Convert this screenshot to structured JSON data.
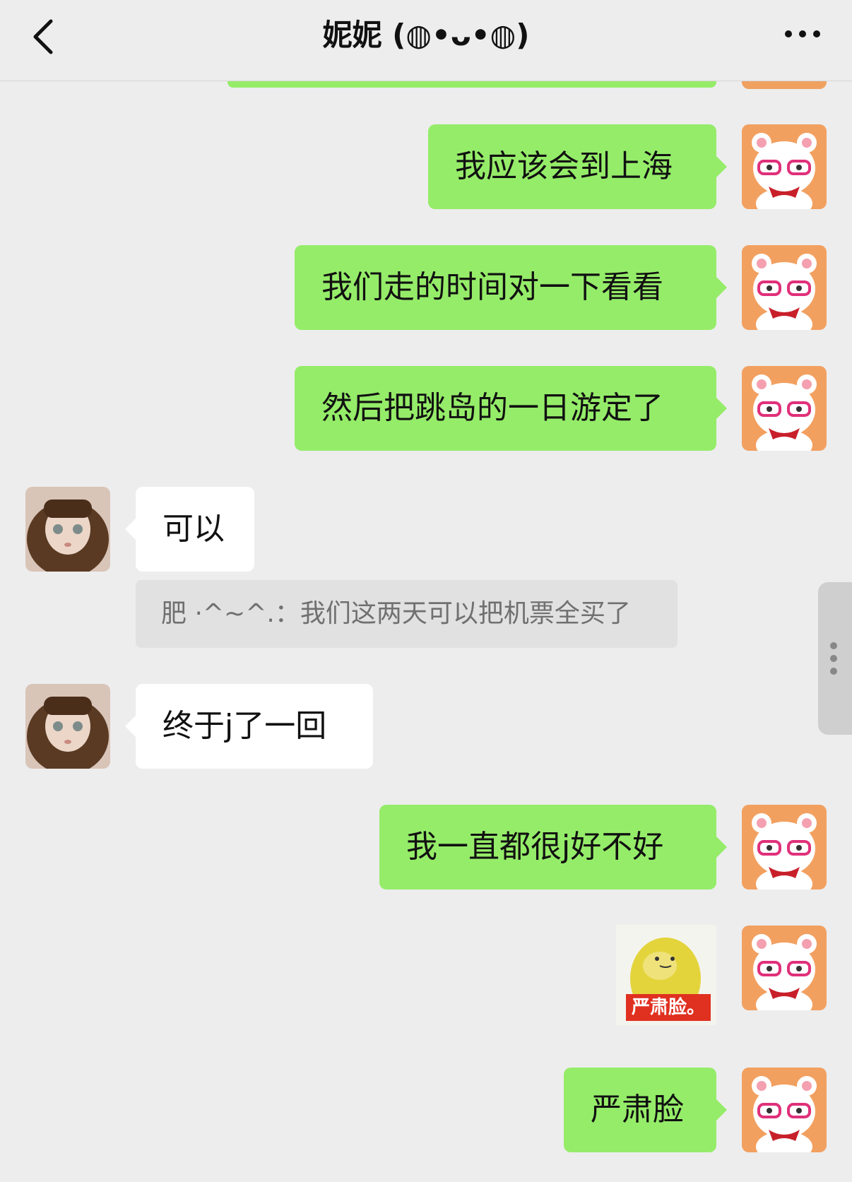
{
  "header": {
    "title": "妮妮 (◍•ᴗ•◍)",
    "back_icon": "chevron-left-icon",
    "more_icon": "more-dots-icon"
  },
  "colors": {
    "background": "#ededed",
    "self_bubble": "#95ec69",
    "other_bubble": "#ffffff",
    "quote_bg": "#e1e1e1",
    "quote_text": "#707070"
  },
  "messages": [
    {
      "sender": "self",
      "type": "text",
      "text": "我应该会到上海"
    },
    {
      "sender": "self",
      "type": "text",
      "text": "我们走的时间对一下看看"
    },
    {
      "sender": "self",
      "type": "text",
      "text": "然后把跳岛的一日游定了"
    },
    {
      "sender": "other",
      "type": "text",
      "text": "可以",
      "quote": "肥 ·^~^.：我们这两天可以把机票全买了"
    },
    {
      "sender": "other",
      "type": "text",
      "text": "终于j了一回"
    },
    {
      "sender": "self",
      "type": "text",
      "text": "我一直都很j好不好"
    },
    {
      "sender": "self",
      "type": "sticker",
      "caption": "严肃脸。"
    },
    {
      "sender": "self",
      "type": "text",
      "text": "严肃脸"
    }
  ]
}
